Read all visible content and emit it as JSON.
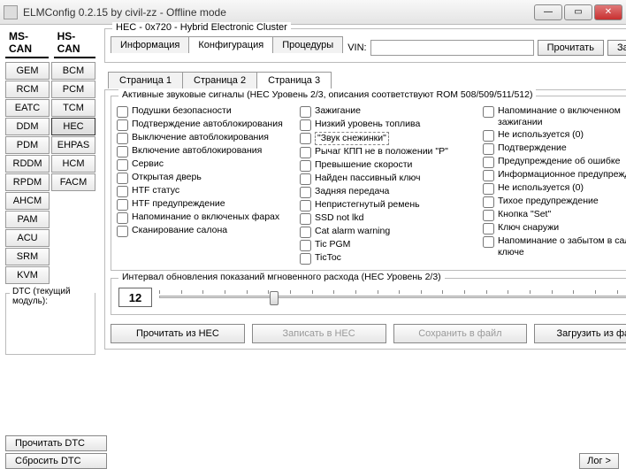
{
  "window": {
    "title": "ELMConfig 0.2.15 by civil-zz - Offline mode"
  },
  "bus_tabs": [
    "MS-CAN",
    "HS-CAN"
  ],
  "ms_can": [
    "GEM",
    "RCM",
    "EATC",
    "DDM",
    "PDM",
    "RDDM",
    "RPDM",
    "AHCM",
    "PAM",
    "ACU",
    "SRM",
    "KVM"
  ],
  "hs_can": [
    "BCM",
    "PCM",
    "TCM",
    "HEC",
    "EHPAS",
    "HCM",
    "FACM"
  ],
  "dtc_label": "DTC (текущий модуль):",
  "read_dtc": "Прочитать DTC",
  "reset_dtc": "Сбросить DTC",
  "header": {
    "title": "HEC - 0x720 - Hybrid Electronic Cluster",
    "tabs": [
      "Информация",
      "Конфигурация",
      "Процедуры"
    ],
    "vin_label": "VIN:",
    "read": "Прочитать",
    "write": "Записать"
  },
  "page_tabs": [
    "Страница 1",
    "Страница 2",
    "Страница 3"
  ],
  "signals_title": "Активные звуковые сигналы (HEC Уровень 2/3, описания соответствуют ROM 508/509/511/512)",
  "col1": [
    "Подушки безопасности",
    "Подтверждение автоблокирования",
    "Выключение автоблокирования",
    "Включение автоблокирования",
    "Сервис",
    "Открытая дверь",
    "HTF статус",
    "HTF предупреждение",
    "Напоминание о включеных фарах",
    "Сканирование салона"
  ],
  "col2": [
    "Зажигание",
    "Низкий уровень топлива",
    "\"Звук снежинки\"",
    "Рычаг КПП не в положении \"P\"",
    "Превышение скорости",
    "Найден пассивный ключ",
    "Задняя передача",
    "Непристегнутый ремень",
    "SSD not lkd",
    "Cat alarm warning",
    "Tic PGM",
    "TicToc"
  ],
  "col3": [
    "Напоминание о включенном зажигании",
    "Не используется (0)",
    "Подтверждение",
    "Предупреждение об ошибке",
    "Информационное предупреждение",
    "Не используется (0)",
    "Тихое предупреждение",
    "Кнопка \"Set\"",
    "Ключ снаружи",
    "Напоминание о забытом в салоне ключе"
  ],
  "interval": {
    "title": "Интервал обновления показаний мгновенного расхода (HEC Уровень 2/3)",
    "value": "12"
  },
  "actions": {
    "read_hec": "Прочитать из HEC",
    "write_hec": "Записать в HEC",
    "save_file": "Сохранить в файл",
    "load_file": "Загрузить из файла"
  },
  "log": "Лог >"
}
